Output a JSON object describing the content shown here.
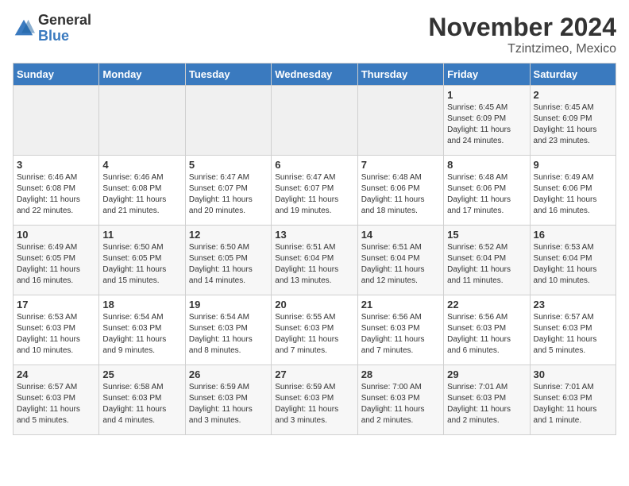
{
  "header": {
    "logo_general": "General",
    "logo_blue": "Blue",
    "month": "November 2024",
    "location": "Tzintzimeo, Mexico"
  },
  "weekdays": [
    "Sunday",
    "Monday",
    "Tuesday",
    "Wednesday",
    "Thursday",
    "Friday",
    "Saturday"
  ],
  "weeks": [
    [
      {
        "day": "",
        "info": ""
      },
      {
        "day": "",
        "info": ""
      },
      {
        "day": "",
        "info": ""
      },
      {
        "day": "",
        "info": ""
      },
      {
        "day": "",
        "info": ""
      },
      {
        "day": "1",
        "info": "Sunrise: 6:45 AM\nSunset: 6:09 PM\nDaylight: 11 hours\nand 24 minutes."
      },
      {
        "day": "2",
        "info": "Sunrise: 6:45 AM\nSunset: 6:09 PM\nDaylight: 11 hours\nand 23 minutes."
      }
    ],
    [
      {
        "day": "3",
        "info": "Sunrise: 6:46 AM\nSunset: 6:08 PM\nDaylight: 11 hours\nand 22 minutes."
      },
      {
        "day": "4",
        "info": "Sunrise: 6:46 AM\nSunset: 6:08 PM\nDaylight: 11 hours\nand 21 minutes."
      },
      {
        "day": "5",
        "info": "Sunrise: 6:47 AM\nSunset: 6:07 PM\nDaylight: 11 hours\nand 20 minutes."
      },
      {
        "day": "6",
        "info": "Sunrise: 6:47 AM\nSunset: 6:07 PM\nDaylight: 11 hours\nand 19 minutes."
      },
      {
        "day": "7",
        "info": "Sunrise: 6:48 AM\nSunset: 6:06 PM\nDaylight: 11 hours\nand 18 minutes."
      },
      {
        "day": "8",
        "info": "Sunrise: 6:48 AM\nSunset: 6:06 PM\nDaylight: 11 hours\nand 17 minutes."
      },
      {
        "day": "9",
        "info": "Sunrise: 6:49 AM\nSunset: 6:06 PM\nDaylight: 11 hours\nand 16 minutes."
      }
    ],
    [
      {
        "day": "10",
        "info": "Sunrise: 6:49 AM\nSunset: 6:05 PM\nDaylight: 11 hours\nand 16 minutes."
      },
      {
        "day": "11",
        "info": "Sunrise: 6:50 AM\nSunset: 6:05 PM\nDaylight: 11 hours\nand 15 minutes."
      },
      {
        "day": "12",
        "info": "Sunrise: 6:50 AM\nSunset: 6:05 PM\nDaylight: 11 hours\nand 14 minutes."
      },
      {
        "day": "13",
        "info": "Sunrise: 6:51 AM\nSunset: 6:04 PM\nDaylight: 11 hours\nand 13 minutes."
      },
      {
        "day": "14",
        "info": "Sunrise: 6:51 AM\nSunset: 6:04 PM\nDaylight: 11 hours\nand 12 minutes."
      },
      {
        "day": "15",
        "info": "Sunrise: 6:52 AM\nSunset: 6:04 PM\nDaylight: 11 hours\nand 11 minutes."
      },
      {
        "day": "16",
        "info": "Sunrise: 6:53 AM\nSunset: 6:04 PM\nDaylight: 11 hours\nand 10 minutes."
      }
    ],
    [
      {
        "day": "17",
        "info": "Sunrise: 6:53 AM\nSunset: 6:03 PM\nDaylight: 11 hours\nand 10 minutes."
      },
      {
        "day": "18",
        "info": "Sunrise: 6:54 AM\nSunset: 6:03 PM\nDaylight: 11 hours\nand 9 minutes."
      },
      {
        "day": "19",
        "info": "Sunrise: 6:54 AM\nSunset: 6:03 PM\nDaylight: 11 hours\nand 8 minutes."
      },
      {
        "day": "20",
        "info": "Sunrise: 6:55 AM\nSunset: 6:03 PM\nDaylight: 11 hours\nand 7 minutes."
      },
      {
        "day": "21",
        "info": "Sunrise: 6:56 AM\nSunset: 6:03 PM\nDaylight: 11 hours\nand 7 minutes."
      },
      {
        "day": "22",
        "info": "Sunrise: 6:56 AM\nSunset: 6:03 PM\nDaylight: 11 hours\nand 6 minutes."
      },
      {
        "day": "23",
        "info": "Sunrise: 6:57 AM\nSunset: 6:03 PM\nDaylight: 11 hours\nand 5 minutes."
      }
    ],
    [
      {
        "day": "24",
        "info": "Sunrise: 6:57 AM\nSunset: 6:03 PM\nDaylight: 11 hours\nand 5 minutes."
      },
      {
        "day": "25",
        "info": "Sunrise: 6:58 AM\nSunset: 6:03 PM\nDaylight: 11 hours\nand 4 minutes."
      },
      {
        "day": "26",
        "info": "Sunrise: 6:59 AM\nSunset: 6:03 PM\nDaylight: 11 hours\nand 3 minutes."
      },
      {
        "day": "27",
        "info": "Sunrise: 6:59 AM\nSunset: 6:03 PM\nDaylight: 11 hours\nand 3 minutes."
      },
      {
        "day": "28",
        "info": "Sunrise: 7:00 AM\nSunset: 6:03 PM\nDaylight: 11 hours\nand 2 minutes."
      },
      {
        "day": "29",
        "info": "Sunrise: 7:01 AM\nSunset: 6:03 PM\nDaylight: 11 hours\nand 2 minutes."
      },
      {
        "day": "30",
        "info": "Sunrise: 7:01 AM\nSunset: 6:03 PM\nDaylight: 11 hours\nand 1 minute."
      }
    ]
  ]
}
